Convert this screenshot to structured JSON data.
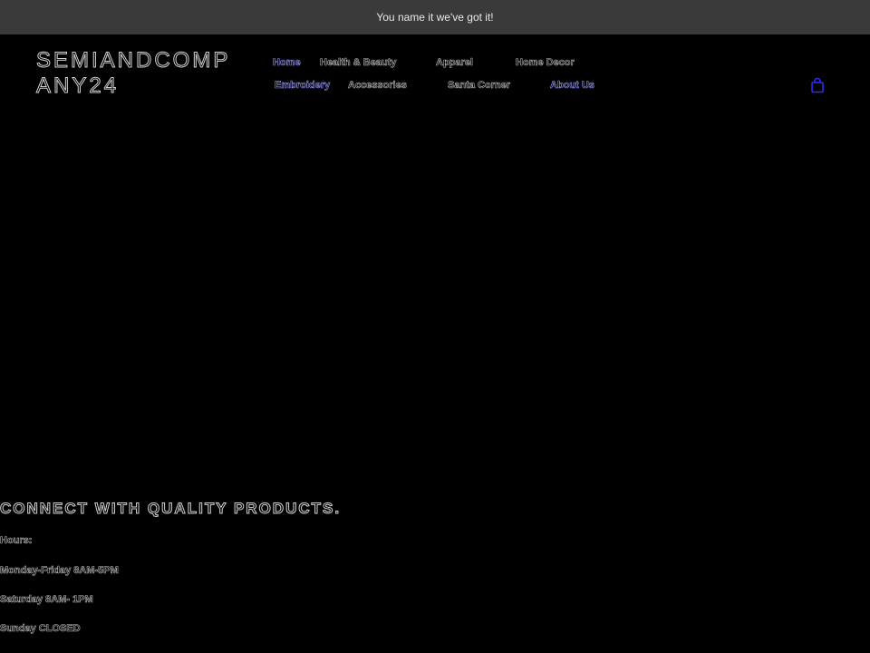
{
  "announcement": "You name it we've got it!",
  "logo": {
    "line1": "SEMIANDCOMP",
    "line2": "ANY24"
  },
  "nav": {
    "row1": [
      "Home",
      "Health & Beauty",
      "Apparel",
      "Home Decor"
    ],
    "row2": [
      "Embroidery",
      "Accessories",
      "Santa Corner",
      "About Us"
    ]
  },
  "cart_icon": "cart-bag-icon",
  "hero": {
    "title": "CONNECT WITH QUALITY PRODUCTS."
  },
  "hours": {
    "heading": "Hours:",
    "lines": [
      "Monday-Friday 8AM-5PM",
      "Saturday 8AM- 1PM",
      "Sunday CLOSED"
    ]
  },
  "colors": {
    "background": "#000000",
    "announcement_bar": "#3a3a3a",
    "nav_accent": "#9a9aff",
    "cart_icon": "#2b2bff"
  }
}
